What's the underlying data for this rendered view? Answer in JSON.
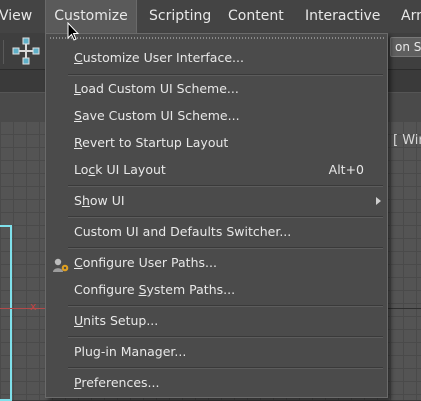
{
  "menubar": {
    "items": [
      "View",
      "Customize",
      "Scripting",
      "Content",
      "Interactive",
      "Arn"
    ]
  },
  "toolbar": {
    "right_field_text": "on Se"
  },
  "viewport": {
    "label": "[ Wir",
    "axis_label": "x"
  },
  "menu": {
    "items": [
      {
        "label": "Customize User Interface...",
        "mnemonic_index": 0
      },
      {
        "label": "Load Custom UI Scheme...",
        "mnemonic_index": 0
      },
      {
        "label": "Save Custom UI Scheme...",
        "mnemonic_index": 0
      },
      {
        "label": "Revert to Startup Layout",
        "mnemonic_index": 0
      },
      {
        "label": "Lock UI Layout",
        "mnemonic_index": 2,
        "shortcut": "Alt+0"
      },
      {
        "label": "Show UI",
        "mnemonic_index": 1,
        "submenu": true
      },
      {
        "label": "Custom UI and Defaults Switcher..."
      },
      {
        "label": "Configure User Paths...",
        "mnemonic_index": 0,
        "icon": "user-paths-icon"
      },
      {
        "label": "Configure System Paths...",
        "mnemonic_index": 10
      },
      {
        "label": "Units Setup...",
        "mnemonic_index": 0
      },
      {
        "label": "Plug-in Manager..."
      },
      {
        "label": "Preferences...",
        "mnemonic_index": 0
      }
    ]
  },
  "colors": {
    "menubar_bg": "#444444",
    "dropdown_bg": "#4b4b4b",
    "viewport_bg": "#545454",
    "selection_box": "#7fe1ec",
    "axis_red": "#b24a4a"
  }
}
